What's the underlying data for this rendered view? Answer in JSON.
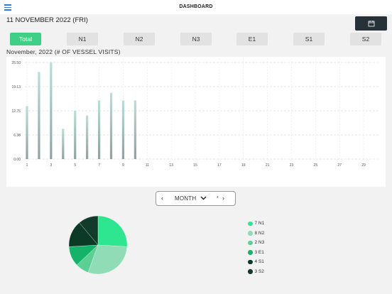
{
  "header": {
    "title": "DASHBOARD",
    "menu_icon": "hamburger-menu-icon"
  },
  "date_label": "11 NOVEMBER 2022 (FRI)",
  "calendar_button": {
    "icon": "calendar-icon",
    "color": "#263238"
  },
  "tabs": [
    {
      "label": "Total",
      "active": true
    },
    {
      "label": "N1",
      "active": false
    },
    {
      "label": "N2",
      "active": false
    },
    {
      "label": "N3",
      "active": false
    },
    {
      "label": "E1",
      "active": false
    },
    {
      "label": "S1",
      "active": false
    },
    {
      "label": "S2",
      "active": false
    }
  ],
  "chart_title": "November, 2022 (# OF VESSEL VISITS)",
  "chart_data": [
    {
      "type": "bar",
      "title": "November, 2022 (# OF VESSEL VISITS)",
      "x": [
        1,
        2,
        3,
        4,
        5,
        6,
        7,
        8,
        9,
        10
      ],
      "values": [
        14,
        23,
        25.5,
        8,
        12.75,
        11.5,
        15.5,
        17.5,
        15.5,
        15.5
      ],
      "x_ticks": [
        "1",
        "3",
        "5",
        "7",
        "9",
        "11",
        "13",
        "15",
        "17",
        "19",
        "21",
        "23",
        "25",
        "27",
        "29"
      ],
      "y_ticks": [
        "0.00",
        "6.38",
        "12.75",
        "19.13",
        "25.50"
      ],
      "ylim": [
        0,
        25.5
      ],
      "xlim": [
        1,
        30
      ],
      "grid": true,
      "bar_color": "#a8bfbc"
    },
    {
      "type": "pie",
      "categories": [
        "N1",
        "N2",
        "N3",
        "E1",
        "S1",
        "S2"
      ],
      "values": [
        7,
        8,
        2,
        3,
        4,
        3
      ],
      "colors": [
        "#2ee68f",
        "#8fdcb6",
        "#5ccf94",
        "#15b36a",
        "#0b3a26",
        "#123b2b"
      ]
    }
  ],
  "month_control": {
    "prev": "‹",
    "label": "MONTH",
    "chevron_icon": "chevron-down-icon",
    "mid": "*",
    "next": "›"
  },
  "legend": [
    {
      "label": "7 N1",
      "color": "#2ee68f"
    },
    {
      "label": "8 N2",
      "color": "#8fdcb6"
    },
    {
      "label": "2 N3",
      "color": "#5ccf94"
    },
    {
      "label": "3 E1",
      "color": "#15b36a"
    },
    {
      "label": "4 S1",
      "color": "#0b3a26"
    },
    {
      "label": "3 S2",
      "color": "#123b2b"
    }
  ]
}
